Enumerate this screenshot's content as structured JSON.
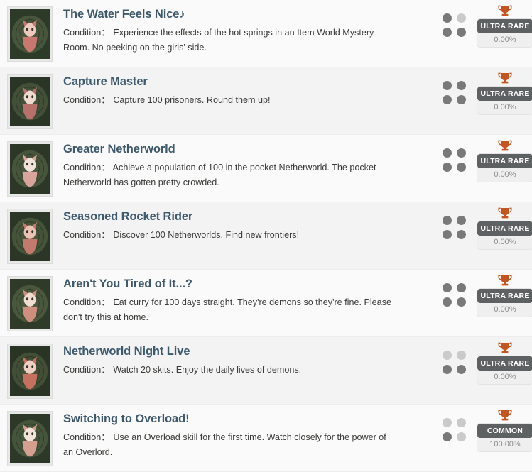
{
  "list": {
    "condition_label": "Condition",
    "condition_separator": "：",
    "trophy_icon": "trophy-icon",
    "colors": {
      "title": "#3d596b",
      "condition": "#3a3a38",
      "trophy": "#c3561f",
      "badge_top": "#5e6161",
      "badge_bottom_text": "#8d8d8d",
      "dot_on": "#797979",
      "dot_off": "#cacaca",
      "row_bg_a": "#fafafa",
      "row_bg_b": "#f3f3f3"
    },
    "items": [
      {
        "title": "The Water Feels Nice♪",
        "condition": "Experience the effects of the hot springs in an Item World Mystery Room. No peeking on the girls' side.",
        "rarity": "ULTRA RARE",
        "percent": "0.00%",
        "dots": [
          1,
          0,
          1,
          1
        ],
        "icon_name": "achievement-thumbnail-cat-demon"
      },
      {
        "title": "Capture Master",
        "condition": "Capture 100 prisoners. Round them up!",
        "rarity": "ULTRA RARE",
        "percent": "0.00%",
        "dots": [
          1,
          1,
          1,
          1
        ],
        "icon_name": "achievement-thumbnail-prisoner"
      },
      {
        "title": "Greater Netherworld",
        "condition": "Achieve a population of 100 in the pocket Netherworld. The pocket Netherworld has gotten pretty crowded.",
        "rarity": "ULTRA RARE",
        "percent": "0.00%",
        "dots": [
          1,
          1,
          1,
          1
        ],
        "icon_name": "achievement-thumbnail-crowd"
      },
      {
        "title": "Seasoned Rocket Rider",
        "condition": "Discover 100 Netherworlds. Find new frontiers!",
        "rarity": "ULTRA RARE",
        "percent": "0.00%",
        "dots": [
          1,
          1,
          1,
          1
        ],
        "icon_name": "achievement-thumbnail-rocket-rider"
      },
      {
        "title": "Aren't You Tired of It...?",
        "condition": "Eat curry for 100 days straight. They're demons so they're fine. Please don't try this at home.",
        "rarity": "ULTRA RARE",
        "percent": "0.00%",
        "dots": [
          1,
          1,
          1,
          1
        ],
        "icon_name": "achievement-thumbnail-curry"
      },
      {
        "title": "Netherworld Night Live",
        "condition": "Watch 20 skits. Enjoy the daily lives of demons.",
        "rarity": "ULTRA RARE",
        "percent": "0.00%",
        "dots": [
          0,
          0,
          1,
          1
        ],
        "icon_name": "achievement-thumbnail-stage"
      },
      {
        "title": "Switching to Overload!",
        "condition": "Use an Overload skill for the first time. Watch closely for the power of an Overlord.",
        "rarity": "COMMON",
        "percent": "100.00%",
        "dots": [
          0,
          0,
          1,
          0
        ],
        "icon_name": "achievement-thumbnail-overload"
      }
    ]
  }
}
